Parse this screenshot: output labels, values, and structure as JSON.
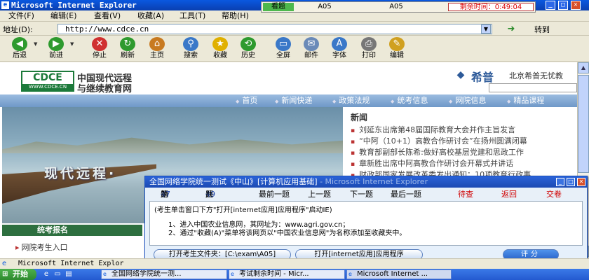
{
  "window": {
    "title": "Microsoft Internet Explorer",
    "min": "_",
    "max": "□",
    "close": "✕"
  },
  "exam_strip": {
    "tag": "看题",
    "field1": "A05",
    "field2": "A05",
    "timer": "剩余时间：0:49:04"
  },
  "menu": [
    "文件(F)",
    "编辑(E)",
    "查看(V)",
    "收藏(A)",
    "工具(T)",
    "帮助(H)"
  ],
  "address": {
    "label": "地址(D):",
    "value": "http://www.cdce.cn",
    "go": "转到"
  },
  "toolbar": [
    {
      "label": "后退",
      "icon": "back-icon",
      "glyph": "◀",
      "color": "#2e9a2e"
    },
    {
      "label": "前进",
      "icon": "forward-icon",
      "glyph": "▶",
      "color": "#2e9a2e"
    },
    {
      "label": "停止",
      "icon": "stop-icon",
      "glyph": "✕",
      "color": "#d03030"
    },
    {
      "label": "刷新",
      "icon": "refresh-icon",
      "glyph": "↻",
      "color": "#2e9a2e"
    },
    {
      "label": "主页",
      "icon": "home-icon",
      "glyph": "⌂",
      "color": "#c87a20"
    },
    {
      "label": "搜索",
      "icon": "search-icon",
      "glyph": "⚲",
      "color": "#3a78c8"
    },
    {
      "label": "收藏",
      "icon": "favorites-icon",
      "glyph": "★",
      "color": "#e0b000"
    },
    {
      "label": "历史",
      "icon": "history-icon",
      "glyph": "⟲",
      "color": "#2e9a2e"
    },
    {
      "label": "全屏",
      "icon": "fullscreen-icon",
      "glyph": "▭",
      "color": "#3a78c8"
    },
    {
      "label": "邮件",
      "icon": "mail-icon",
      "glyph": "✉",
      "color": "#6a8ab8"
    },
    {
      "label": "字体",
      "icon": "font-icon",
      "glyph": "A",
      "color": "#3a78c8"
    },
    {
      "label": "打印",
      "icon": "print-icon",
      "glyph": "⎙",
      "color": "#777777"
    },
    {
      "label": "编辑",
      "icon": "edit-icon",
      "glyph": "✎",
      "color": "#d0a020"
    }
  ],
  "site": {
    "logo_text": "CDCE",
    "logo_url": "WWW.CDCE.CN",
    "title_line1": "中国现代远程",
    "title_line2": "与继续教育网",
    "partner_name": "希普",
    "partner_company": "北京希普无忧教",
    "nav": [
      "首页",
      "新闻快递",
      "政策法规",
      "统考信息",
      "网院信息",
      "精品课程"
    ],
    "slogan": "现代远程·",
    "news_title": "新闻",
    "news": [
      "刘延东出席第48届国际教育大会并作主旨发言",
      "“中阿（10+1）高教合作研讨会”在扬州圆满闭幕",
      "教育部副部长陈希:做好高校基层党建和思政工作",
      "章新胜出席中阿高教合作研讨会开幕式并讲话",
      "财政部国家发展改革委发出通知：10项教育行政事"
    ],
    "signup_bar": "统考报名",
    "entry_link": "网院考生入口"
  },
  "dialog": {
    "title": "全国网络学院统一测试《中山》[计算机应用基础]",
    "title_ghost": "- Microsoft Internet Explorer",
    "nav": {
      "question_prefix": "第",
      "question_no": "47",
      "question_suffix": "题",
      "total_prefix": "共",
      "total_no": "49",
      "total_suffix": "题",
      "first": "最前一题",
      "prev": "上一题",
      "next": "下一题",
      "last": "最后一题",
      "pending": "待查",
      "back": "返回",
      "submit": "交卷"
    },
    "body": {
      "instruction": "(考生单击窗口下方\"打开[internet应用]应用程序\"启动IE)",
      "step1": "1、进入中国农业信息网，其网址为：www.agri.gov.cn；",
      "step2": "2、通过\"收藏(A)\"菜单将该网页以\"中国农业信息网\"为名称添加至收藏夹中。"
    },
    "btn_open_folder": "打开考生文件夹：[C:\\exam\\A05]",
    "btn_open_app": "打开[internet应用]应用程序",
    "btn_score": "评分"
  },
  "statusbar": {
    "text": "Microsoft Internet Explor"
  },
  "taskbar": {
    "start": "开始",
    "tasks": [
      "全国网络学院统一测...",
      "考试剩余时间 - Micr...",
      "Microsoft Internet ..."
    ]
  }
}
